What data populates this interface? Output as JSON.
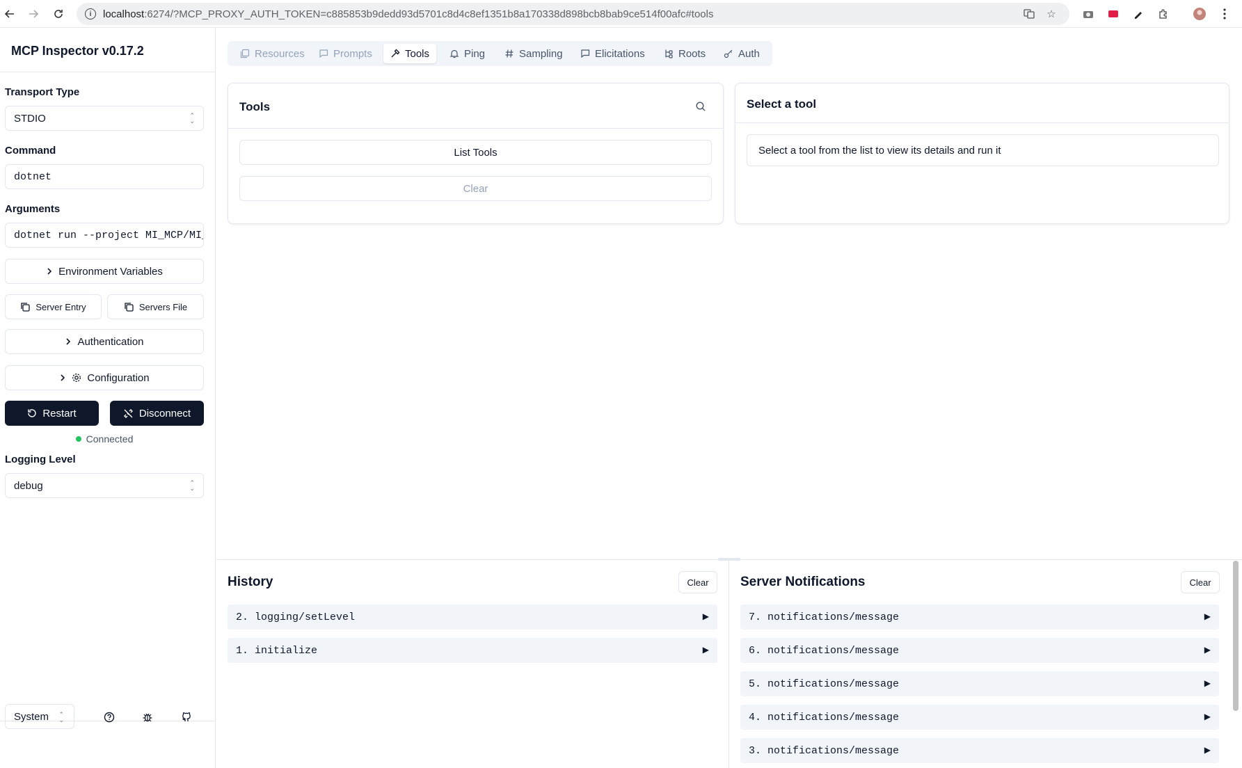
{
  "browser": {
    "url_host": "localhost",
    "url_path": ":6274/?MCP_PROXY_AUTH_TOKEN=c885853b9dedd93d5701c8d4c8ef1351b8a170338d898bcb8bab9ce514f00afc#tools"
  },
  "sidebar": {
    "app_title": "MCP Inspector v0.17.2",
    "transport_label": "Transport Type",
    "transport_value": "STDIO",
    "command_label": "Command",
    "command_value": "dotnet",
    "arguments_label": "Arguments",
    "arguments_value": "dotnet run --project MI_MCP/MI_",
    "env_vars_label": "Environment Variables",
    "server_entry_label": "Server Entry",
    "servers_file_label": "Servers File",
    "authentication_label": "Authentication",
    "configuration_label": "Configuration",
    "restart_label": "Restart",
    "disconnect_label": "Disconnect",
    "status_text": "Connected",
    "logging_label": "Logging Level",
    "logging_value": "debug",
    "theme_value": "System"
  },
  "tabs": [
    {
      "label": "Resources",
      "icon": "resources-icon",
      "state": "disabled"
    },
    {
      "label": "Prompts",
      "icon": "prompts-icon",
      "state": "disabled"
    },
    {
      "label": "Tools",
      "icon": "hammer-icon",
      "state": "active"
    },
    {
      "label": "Ping",
      "icon": "bell-icon",
      "state": "normal"
    },
    {
      "label": "Sampling",
      "icon": "hash-icon",
      "state": "normal"
    },
    {
      "label": "Elicitations",
      "icon": "message-icon",
      "state": "normal"
    },
    {
      "label": "Roots",
      "icon": "tree-icon",
      "state": "normal"
    },
    {
      "label": "Auth",
      "icon": "key-icon",
      "state": "normal"
    }
  ],
  "tools_panel": {
    "title": "Tools",
    "list_button": "List Tools",
    "clear_button": "Clear"
  },
  "detail_panel": {
    "title": "Select a tool",
    "hint": "Select a tool from the list to view its details and run it"
  },
  "history": {
    "title": "History",
    "clear_button": "Clear",
    "items": [
      "2. logging/setLevel",
      "1. initialize"
    ]
  },
  "notifications": {
    "title": "Server Notifications",
    "clear_button": "Clear",
    "items": [
      "7. notifications/message",
      "6. notifications/message",
      "5. notifications/message",
      "4. notifications/message",
      "3. notifications/message"
    ]
  },
  "colors": {
    "primary_dark": "#0f172a",
    "status_green": "#22c55e",
    "muted": "#94a3b8",
    "row_bg": "#f1f5f9"
  }
}
